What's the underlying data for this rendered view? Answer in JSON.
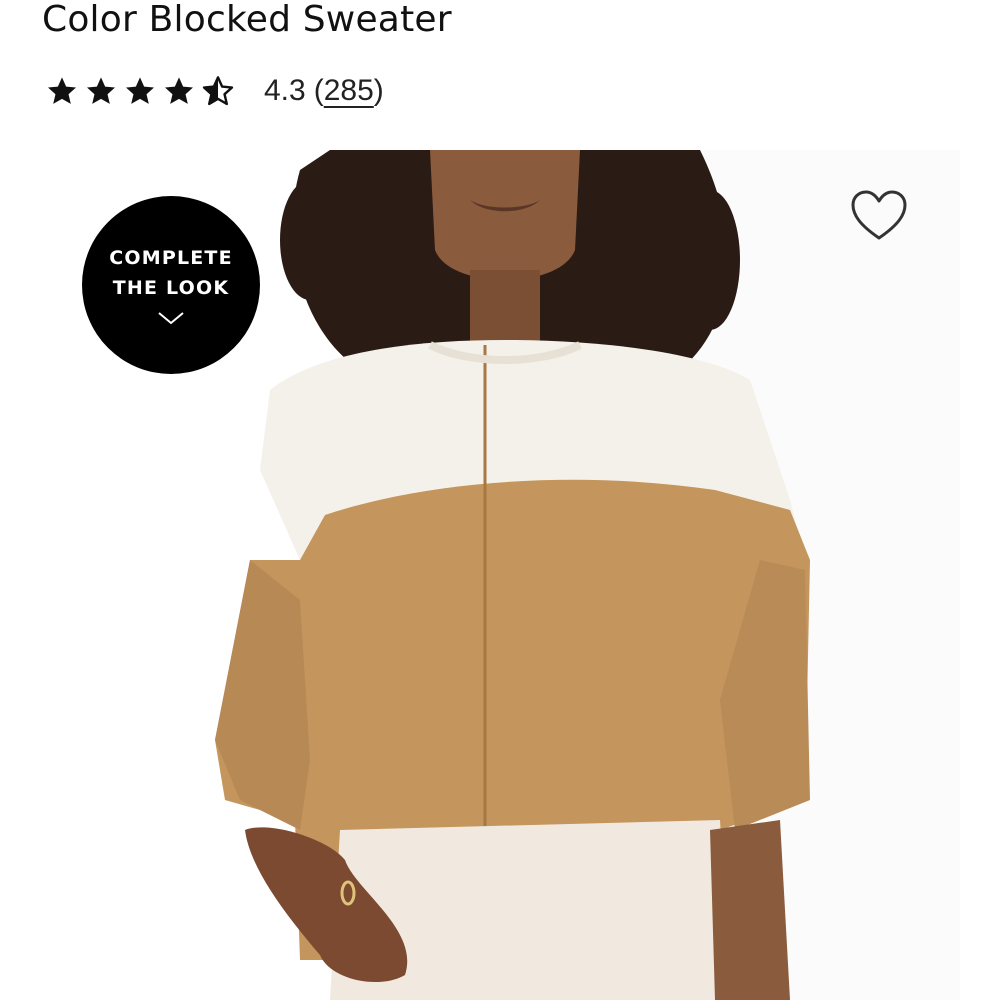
{
  "product": {
    "title": "Color Blocked Sweater"
  },
  "rating": {
    "value": "4.3",
    "stars_out_of_5": 4.3,
    "review_count_open": "(",
    "review_count": "285",
    "review_count_close": ")"
  },
  "complete_look": {
    "line1": "COMPLETE",
    "line2": "THE LOOK",
    "icon": "chevron-down-icon"
  },
  "wishlist": {
    "icon": "heart-outline-icon"
  },
  "colors": {
    "text": "#111111",
    "badge_bg": "#000000",
    "badge_text": "#ffffff",
    "sweater_camel": "#c4955c",
    "sweater_cream": "#f4f1ea",
    "pants_cream": "#f1e9df"
  }
}
